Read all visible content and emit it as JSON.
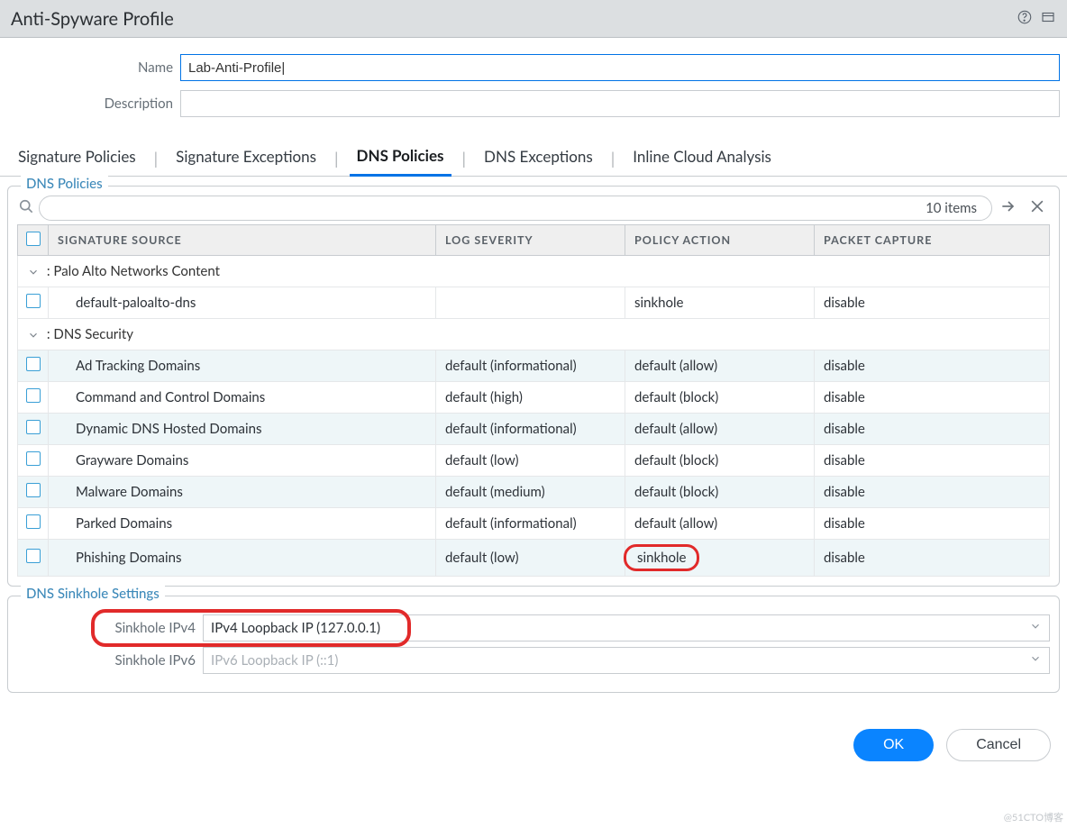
{
  "window": {
    "title": "Anti-Spyware Profile"
  },
  "form": {
    "name_label": "Name",
    "name_value": "Lab-Anti-Profile|",
    "desc_label": "Description",
    "desc_value": ""
  },
  "tabs": [
    {
      "label": "Signature Policies",
      "active": false
    },
    {
      "label": "Signature Exceptions",
      "active": false
    },
    {
      "label": "DNS Policies",
      "active": true
    },
    {
      "label": "DNS Exceptions",
      "active": false
    },
    {
      "label": "Inline Cloud Analysis",
      "active": false
    }
  ],
  "dns_policies": {
    "legend": "DNS Policies",
    "item_count": "10 items",
    "columns": {
      "sig": "SIGNATURE SOURCE",
      "log": "LOG SEVERITY",
      "action": "POLICY ACTION",
      "pcap": "PACKET CAPTURE"
    },
    "groups": [
      {
        "label": ": Palo Alto Networks Content",
        "rows": [
          {
            "sig": "default-paloalto-dns",
            "log": "",
            "action": "sinkhole",
            "pcap": "disable",
            "alt": false,
            "highlight_action": false
          }
        ]
      },
      {
        "label": ": DNS Security",
        "rows": [
          {
            "sig": "Ad Tracking Domains",
            "log": "default (informational)",
            "action": "default (allow)",
            "pcap": "disable",
            "alt": true,
            "highlight_action": false
          },
          {
            "sig": "Command and Control Domains",
            "log": "default (high)",
            "action": "default (block)",
            "pcap": "disable",
            "alt": false,
            "highlight_action": false
          },
          {
            "sig": "Dynamic DNS Hosted Domains",
            "log": "default (informational)",
            "action": "default (allow)",
            "pcap": "disable",
            "alt": true,
            "highlight_action": false
          },
          {
            "sig": "Grayware Domains",
            "log": "default (low)",
            "action": "default (block)",
            "pcap": "disable",
            "alt": false,
            "highlight_action": false
          },
          {
            "sig": "Malware Domains",
            "log": "default (medium)",
            "action": "default (block)",
            "pcap": "disable",
            "alt": true,
            "highlight_action": false
          },
          {
            "sig": "Parked Domains",
            "log": "default (informational)",
            "action": "default (allow)",
            "pcap": "disable",
            "alt": false,
            "highlight_action": false
          },
          {
            "sig": "Phishing Domains",
            "log": "default (low)",
            "action": "sinkhole",
            "pcap": "disable",
            "alt": true,
            "highlight_action": true
          }
        ]
      }
    ]
  },
  "sinkhole": {
    "legend": "DNS Sinkhole Settings",
    "ipv4_label": "Sinkhole IPv4",
    "ipv4_value": "IPv4 Loopback IP (127.0.0.1)",
    "ipv6_label": "Sinkhole IPv6",
    "ipv6_value": "IPv6 Loopback IP (::1)"
  },
  "footer": {
    "ok": "OK",
    "cancel": "Cancel"
  },
  "watermark": "@51CTO博客"
}
